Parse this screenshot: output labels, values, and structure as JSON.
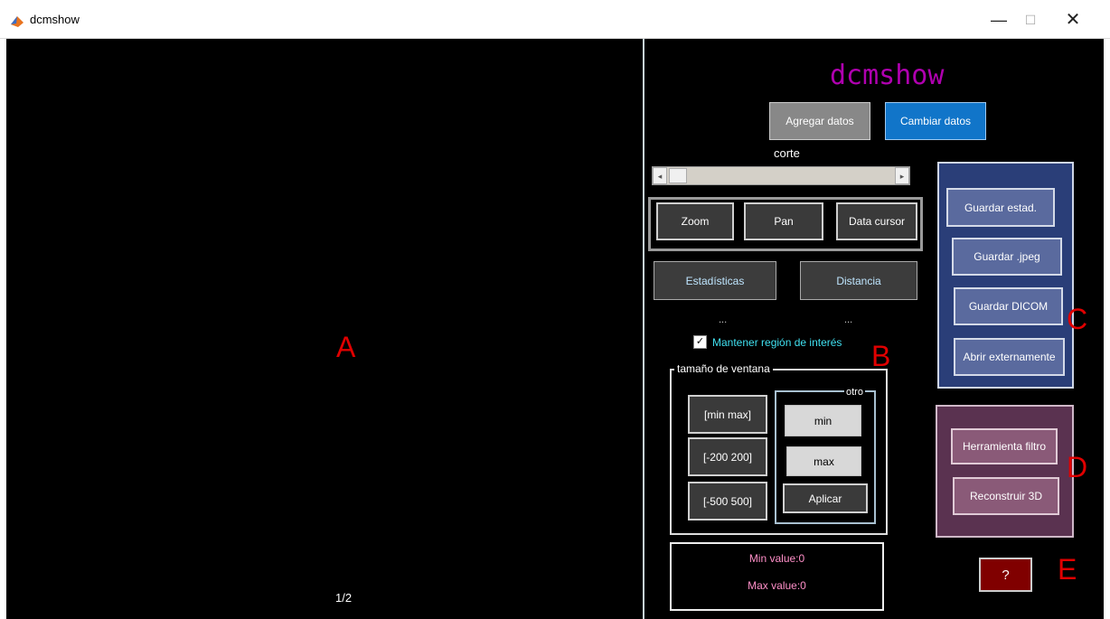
{
  "window": {
    "title": "dcmshow",
    "minimize": "—",
    "maximize": "☐",
    "close": "✕"
  },
  "viewer": {
    "slice_counter": "1/2",
    "label": "A"
  },
  "app_title": "dcmshow",
  "data_buttons": {
    "add": "Agregar datos",
    "change": "Cambiar datos"
  },
  "slider": {
    "label": "corte",
    "left_arrow": "◂",
    "right_arrow": "▸",
    "value": 0.0
  },
  "tools": {
    "zoom": "Zoom",
    "pan": "Pan",
    "data_cursor": "Data cursor"
  },
  "analysis": {
    "stats": "Estadísticas",
    "distance": "Distancia",
    "stats_value": "...",
    "distance_value": "..."
  },
  "roi": {
    "checked": true,
    "label": "Mantener región de interés",
    "check_mark": "✓"
  },
  "window_size": {
    "title": "tamaño de ventana",
    "presets": [
      "[min max]",
      "[-200 200]",
      "[-500 500]"
    ],
    "other_title": "otro",
    "min_placeholder": "min",
    "max_placeholder": "max",
    "apply": "Aplicar"
  },
  "values": {
    "min": "Min value:0",
    "max": "Max value:0"
  },
  "save": {
    "stats": "Guardar estad.",
    "jpeg": "Guardar .jpeg",
    "dicom": "Guardar  DICOM",
    "open_external": "Abrir externamente"
  },
  "filters": {
    "filter_tool": "Herramienta filtro",
    "reconstruct": "Reconstruir 3D"
  },
  "help": "?",
  "region_labels": {
    "b": "B",
    "c": "C",
    "d": "D",
    "e": "E"
  },
  "colors": {
    "title": "#b000b0",
    "save_panel": "#2a3e78",
    "tools_panel": "#5a3250",
    "change_button": "#1175c9",
    "help_button": "#800000",
    "label": "#e00000"
  }
}
